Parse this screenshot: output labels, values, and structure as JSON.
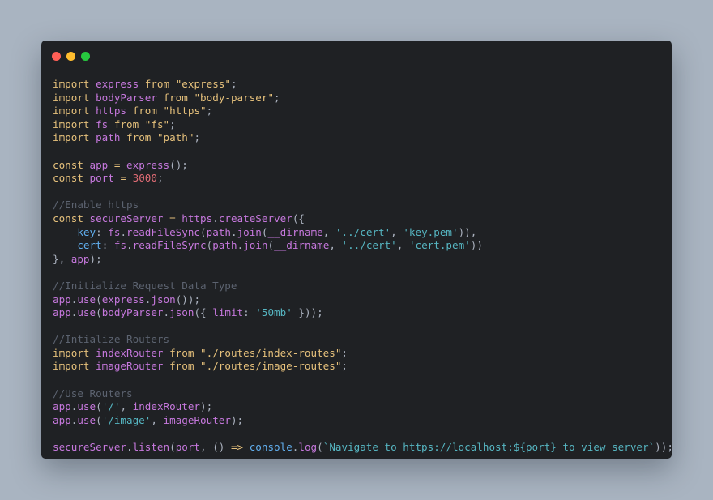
{
  "editor": {
    "lines": [
      [
        {
          "t": "import",
          "c": "keyword"
        },
        {
          "t": " ",
          "c": "plain"
        },
        {
          "t": "express",
          "c": "ident"
        },
        {
          "t": " ",
          "c": "plain"
        },
        {
          "t": "from",
          "c": "keyword"
        },
        {
          "t": " ",
          "c": "plain"
        },
        {
          "t": "\"express\"",
          "c": "string"
        },
        {
          "t": ";",
          "c": "punct"
        }
      ],
      [
        {
          "t": "import",
          "c": "keyword"
        },
        {
          "t": " ",
          "c": "plain"
        },
        {
          "t": "bodyParser",
          "c": "ident"
        },
        {
          "t": " ",
          "c": "plain"
        },
        {
          "t": "from",
          "c": "keyword"
        },
        {
          "t": " ",
          "c": "plain"
        },
        {
          "t": "\"body-parser\"",
          "c": "string"
        },
        {
          "t": ";",
          "c": "punct"
        }
      ],
      [
        {
          "t": "import",
          "c": "keyword"
        },
        {
          "t": " ",
          "c": "plain"
        },
        {
          "t": "https",
          "c": "ident"
        },
        {
          "t": " ",
          "c": "plain"
        },
        {
          "t": "from",
          "c": "keyword"
        },
        {
          "t": " ",
          "c": "plain"
        },
        {
          "t": "\"https\"",
          "c": "string"
        },
        {
          "t": ";",
          "c": "punct"
        }
      ],
      [
        {
          "t": "import",
          "c": "keyword"
        },
        {
          "t": " ",
          "c": "plain"
        },
        {
          "t": "fs",
          "c": "ident"
        },
        {
          "t": " ",
          "c": "plain"
        },
        {
          "t": "from",
          "c": "keyword"
        },
        {
          "t": " ",
          "c": "plain"
        },
        {
          "t": "\"fs\"",
          "c": "string"
        },
        {
          "t": ";",
          "c": "punct"
        }
      ],
      [
        {
          "t": "import",
          "c": "keyword"
        },
        {
          "t": " ",
          "c": "plain"
        },
        {
          "t": "path",
          "c": "ident"
        },
        {
          "t": " ",
          "c": "plain"
        },
        {
          "t": "from",
          "c": "keyword"
        },
        {
          "t": " ",
          "c": "plain"
        },
        {
          "t": "\"path\"",
          "c": "string"
        },
        {
          "t": ";",
          "c": "punct"
        }
      ],
      [],
      [
        {
          "t": "const",
          "c": "keyword"
        },
        {
          "t": " ",
          "c": "plain"
        },
        {
          "t": "app",
          "c": "ident"
        },
        {
          "t": " ",
          "c": "plain"
        },
        {
          "t": "=",
          "c": "op"
        },
        {
          "t": " ",
          "c": "plain"
        },
        {
          "t": "express",
          "c": "fn"
        },
        {
          "t": "();",
          "c": "punct"
        }
      ],
      [
        {
          "t": "const",
          "c": "keyword"
        },
        {
          "t": " ",
          "c": "plain"
        },
        {
          "t": "port",
          "c": "ident"
        },
        {
          "t": " ",
          "c": "plain"
        },
        {
          "t": "=",
          "c": "op"
        },
        {
          "t": " ",
          "c": "plain"
        },
        {
          "t": "3000",
          "c": "number"
        },
        {
          "t": ";",
          "c": "punct"
        }
      ],
      [],
      [
        {
          "t": "//Enable https",
          "c": "comment"
        }
      ],
      [
        {
          "t": "const",
          "c": "keyword"
        },
        {
          "t": " ",
          "c": "plain"
        },
        {
          "t": "secureServer",
          "c": "ident"
        },
        {
          "t": " ",
          "c": "plain"
        },
        {
          "t": "=",
          "c": "op"
        },
        {
          "t": " ",
          "c": "plain"
        },
        {
          "t": "https",
          "c": "ident"
        },
        {
          "t": ".",
          "c": "punct"
        },
        {
          "t": "createServer",
          "c": "fn"
        },
        {
          "t": "({",
          "c": "punct"
        }
      ],
      [
        {
          "t": "    ",
          "c": "plain"
        },
        {
          "t": "key",
          "c": "prop"
        },
        {
          "t": ": ",
          "c": "punct"
        },
        {
          "t": "fs",
          "c": "ident"
        },
        {
          "t": ".",
          "c": "punct"
        },
        {
          "t": "readFileSync",
          "c": "fn"
        },
        {
          "t": "(",
          "c": "punct"
        },
        {
          "t": "path",
          "c": "ident"
        },
        {
          "t": ".",
          "c": "punct"
        },
        {
          "t": "join",
          "c": "fn"
        },
        {
          "t": "(",
          "c": "punct"
        },
        {
          "t": "__dirname",
          "c": "ident"
        },
        {
          "t": ", ",
          "c": "punct"
        },
        {
          "t": "'../cert'",
          "c": "sq"
        },
        {
          "t": ", ",
          "c": "punct"
        },
        {
          "t": "'key.pem'",
          "c": "sq"
        },
        {
          "t": ")),",
          "c": "punct"
        }
      ],
      [
        {
          "t": "    ",
          "c": "plain"
        },
        {
          "t": "cert",
          "c": "prop"
        },
        {
          "t": ": ",
          "c": "punct"
        },
        {
          "t": "fs",
          "c": "ident"
        },
        {
          "t": ".",
          "c": "punct"
        },
        {
          "t": "readFileSync",
          "c": "fn"
        },
        {
          "t": "(",
          "c": "punct"
        },
        {
          "t": "path",
          "c": "ident"
        },
        {
          "t": ".",
          "c": "punct"
        },
        {
          "t": "join",
          "c": "fn"
        },
        {
          "t": "(",
          "c": "punct"
        },
        {
          "t": "__dirname",
          "c": "ident"
        },
        {
          "t": ", ",
          "c": "punct"
        },
        {
          "t": "'../cert'",
          "c": "sq"
        },
        {
          "t": ", ",
          "c": "punct"
        },
        {
          "t": "'cert.pem'",
          "c": "sq"
        },
        {
          "t": "))",
          "c": "punct"
        }
      ],
      [
        {
          "t": "}, ",
          "c": "punct"
        },
        {
          "t": "app",
          "c": "ident"
        },
        {
          "t": ");",
          "c": "punct"
        }
      ],
      [],
      [
        {
          "t": "//Initialize Request Data Type",
          "c": "comment"
        }
      ],
      [
        {
          "t": "app",
          "c": "ident"
        },
        {
          "t": ".",
          "c": "punct"
        },
        {
          "t": "use",
          "c": "fn"
        },
        {
          "t": "(",
          "c": "punct"
        },
        {
          "t": "express",
          "c": "ident"
        },
        {
          "t": ".",
          "c": "punct"
        },
        {
          "t": "json",
          "c": "fn"
        },
        {
          "t": "());",
          "c": "punct"
        }
      ],
      [
        {
          "t": "app",
          "c": "ident"
        },
        {
          "t": ".",
          "c": "punct"
        },
        {
          "t": "use",
          "c": "fn"
        },
        {
          "t": "(",
          "c": "punct"
        },
        {
          "t": "bodyParser",
          "c": "ident"
        },
        {
          "t": ".",
          "c": "punct"
        },
        {
          "t": "json",
          "c": "fn"
        },
        {
          "t": "({ ",
          "c": "punct"
        },
        {
          "t": "limit",
          "c": "ident"
        },
        {
          "t": ": ",
          "c": "punct"
        },
        {
          "t": "'50mb'",
          "c": "sq"
        },
        {
          "t": " }));",
          "c": "punct"
        }
      ],
      [],
      [
        {
          "t": "//Intialize Routers",
          "c": "comment"
        }
      ],
      [
        {
          "t": "import",
          "c": "keyword"
        },
        {
          "t": " ",
          "c": "plain"
        },
        {
          "t": "indexRouter",
          "c": "ident"
        },
        {
          "t": " ",
          "c": "plain"
        },
        {
          "t": "from",
          "c": "keyword"
        },
        {
          "t": " ",
          "c": "plain"
        },
        {
          "t": "\"./routes/index-routes\"",
          "c": "string"
        },
        {
          "t": ";",
          "c": "punct"
        }
      ],
      [
        {
          "t": "import",
          "c": "keyword"
        },
        {
          "t": " ",
          "c": "plain"
        },
        {
          "t": "imageRouter",
          "c": "ident"
        },
        {
          "t": " ",
          "c": "plain"
        },
        {
          "t": "from",
          "c": "keyword"
        },
        {
          "t": " ",
          "c": "plain"
        },
        {
          "t": "\"./routes/image-routes\"",
          "c": "string"
        },
        {
          "t": ";",
          "c": "punct"
        }
      ],
      [],
      [
        {
          "t": "//Use Routers",
          "c": "comment"
        }
      ],
      [
        {
          "t": "app",
          "c": "ident"
        },
        {
          "t": ".",
          "c": "punct"
        },
        {
          "t": "use",
          "c": "fn"
        },
        {
          "t": "(",
          "c": "punct"
        },
        {
          "t": "'/'",
          "c": "sq"
        },
        {
          "t": ", ",
          "c": "punct"
        },
        {
          "t": "indexRouter",
          "c": "ident"
        },
        {
          "t": ");",
          "c": "punct"
        }
      ],
      [
        {
          "t": "app",
          "c": "ident"
        },
        {
          "t": ".",
          "c": "punct"
        },
        {
          "t": "use",
          "c": "fn"
        },
        {
          "t": "(",
          "c": "punct"
        },
        {
          "t": "'/image'",
          "c": "sq"
        },
        {
          "t": ", ",
          "c": "punct"
        },
        {
          "t": "imageRouter",
          "c": "ident"
        },
        {
          "t": ");",
          "c": "punct"
        }
      ],
      [],
      [
        {
          "t": "secureServer",
          "c": "ident"
        },
        {
          "t": ".",
          "c": "punct"
        },
        {
          "t": "listen",
          "c": "fn"
        },
        {
          "t": "(",
          "c": "punct"
        },
        {
          "t": "port",
          "c": "ident"
        },
        {
          "t": ", () ",
          "c": "punct"
        },
        {
          "t": "=>",
          "c": "op"
        },
        {
          "t": " ",
          "c": "plain"
        },
        {
          "t": "console",
          "c": "prop"
        },
        {
          "t": ".",
          "c": "punct"
        },
        {
          "t": "log",
          "c": "fn"
        },
        {
          "t": "(",
          "c": "punct"
        },
        {
          "t": "`Navigate to https://localhost:${port} to view server`",
          "c": "sq"
        },
        {
          "t": "));",
          "c": "punct"
        }
      ]
    ]
  }
}
